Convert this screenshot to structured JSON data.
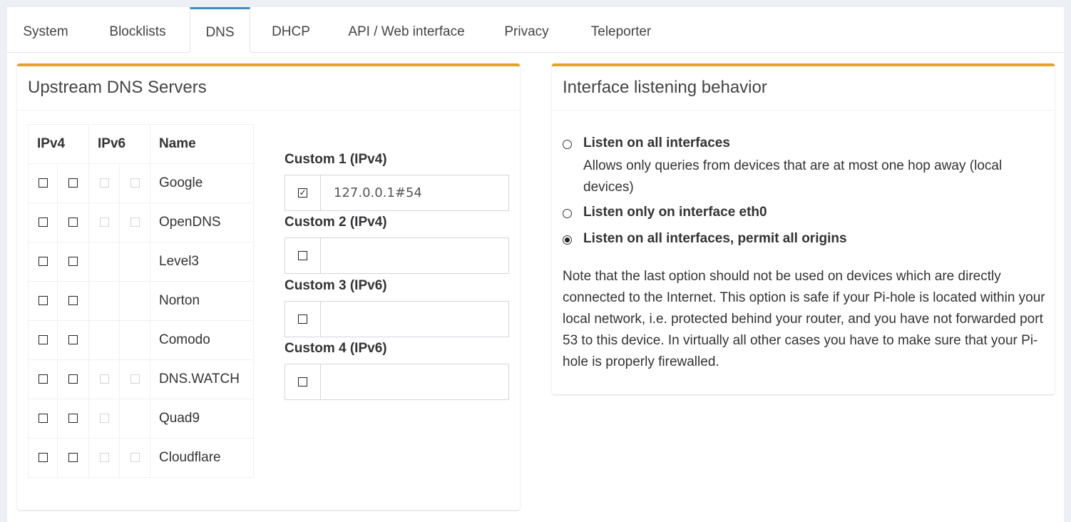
{
  "tabs": [
    {
      "label": "System"
    },
    {
      "label": "Blocklists"
    },
    {
      "label": "DNS"
    },
    {
      "label": "DHCP"
    },
    {
      "label": "API / Web interface"
    },
    {
      "label": "Privacy"
    },
    {
      "label": "Teleporter"
    }
  ],
  "active_tab": "DNS",
  "upstream": {
    "title": "Upstream DNS Servers",
    "headers": {
      "ipv4": "IPv4",
      "ipv6": "IPv6",
      "name": "Name"
    },
    "servers": [
      {
        "name": "Google",
        "ipv6": [
          true,
          true
        ]
      },
      {
        "name": "OpenDNS",
        "ipv6": [
          true,
          true
        ]
      },
      {
        "name": "Level3",
        "ipv6": [
          false,
          false
        ]
      },
      {
        "name": "Norton",
        "ipv6": [
          false,
          false
        ]
      },
      {
        "name": "Comodo",
        "ipv6": [
          false,
          false
        ]
      },
      {
        "name": "DNS.WATCH",
        "ipv6": [
          true,
          true
        ]
      },
      {
        "name": "Quad9",
        "ipv6": [
          true,
          false
        ]
      },
      {
        "name": "Cloudflare",
        "ipv6": [
          true,
          true
        ]
      }
    ],
    "custom": [
      {
        "label": "Custom 1 (IPv4)",
        "checked": true,
        "value": "127.0.0.1#54"
      },
      {
        "label": "Custom 2 (IPv4)",
        "checked": false,
        "value": ""
      },
      {
        "label": "Custom 3 (IPv6)",
        "checked": false,
        "value": ""
      },
      {
        "label": "Custom 4 (IPv6)",
        "checked": false,
        "value": ""
      }
    ]
  },
  "interface": {
    "title": "Interface listening behavior",
    "options": [
      {
        "label": "Listen on all interfaces",
        "description": "Allows only queries from devices that are at most one hop away (local devices)",
        "selected": false
      },
      {
        "label": "Listen only on interface eth0",
        "description": "",
        "selected": false
      },
      {
        "label": "Listen on all interfaces, permit all origins",
        "description": "",
        "selected": true
      }
    ],
    "note": "Note that the last option should not be used on devices which are directly connected to the Internet. This option is safe if your Pi-hole is located within your local network, i.e. protected behind your router, and you have not forwarded port 53 to this device. In virtually all other cases you have to make sure that your Pi-hole is properly firewalled."
  },
  "colors": {
    "accent_tab": "#3c8dbc",
    "box_border": "#e3a427"
  }
}
